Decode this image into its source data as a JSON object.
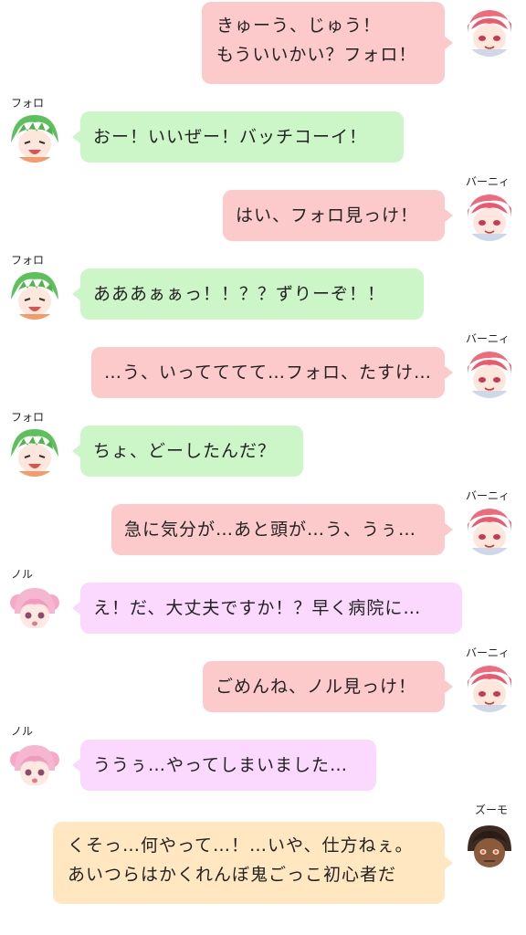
{
  "colors": {
    "bunny_bubble": "#fccaca",
    "foro_bubble": "#ccf6c8",
    "noru_bubble": "#fbd8fe",
    "zumo_bubble": "#ffe7c1"
  },
  "messages": [
    {
      "speaker": "",
      "side": "right",
      "lines": [
        "きゅーう、じゅう！",
        "もういいかい？フォロ！"
      ],
      "avatar_icon": "bunny-avatar-icon"
    },
    {
      "speaker": "フォロ",
      "side": "left",
      "lines": [
        "おー！いいぜー！バッチコーイ！"
      ],
      "avatar_icon": "foro-avatar-icon"
    },
    {
      "speaker": "バーニィ",
      "side": "right",
      "lines": [
        "はい、フォロ見っけ！"
      ],
      "avatar_icon": "bunny-avatar-icon"
    },
    {
      "speaker": "フォロ",
      "side": "left",
      "lines": [
        "あああぁぁっ！！？？ずりーぞ！！"
      ],
      "avatar_icon": "foro-avatar-icon"
    },
    {
      "speaker": "バーニィ",
      "side": "right",
      "lines": [
        "…う、いってててて…フォロ、たすけ…"
      ],
      "avatar_icon": "bunny-avatar-icon"
    },
    {
      "speaker": "フォロ",
      "side": "left",
      "lines": [
        "ちょ、どーしたんだ？"
      ],
      "avatar_icon": "foro-avatar-icon"
    },
    {
      "speaker": "バーニィ",
      "side": "right",
      "lines": [
        "急に気分が…あと頭が…う、うぅ…"
      ],
      "avatar_icon": "bunny-avatar-icon"
    },
    {
      "speaker": "ノル",
      "side": "left",
      "lines": [
        "え！だ、大丈夫ですか！？早く病院に…"
      ],
      "avatar_icon": "noru-avatar-icon"
    },
    {
      "speaker": "バーニィ",
      "side": "right",
      "lines": [
        "ごめんね、ノル見っけ！"
      ],
      "avatar_icon": "bunny-avatar-icon"
    },
    {
      "speaker": "ノル",
      "side": "left",
      "lines": [
        "ううぅ…やってしまいました…"
      ],
      "avatar_icon": "noru-avatar-icon"
    },
    {
      "speaker": "ズーモ",
      "side": "right",
      "lines": [
        "くそっ…何やって…！…いや、仕方ねぇ。",
        "あいつらはかくれんぼ鬼ごっこ初心者だ"
      ],
      "avatar_icon": "zumo-avatar-icon"
    }
  ]
}
